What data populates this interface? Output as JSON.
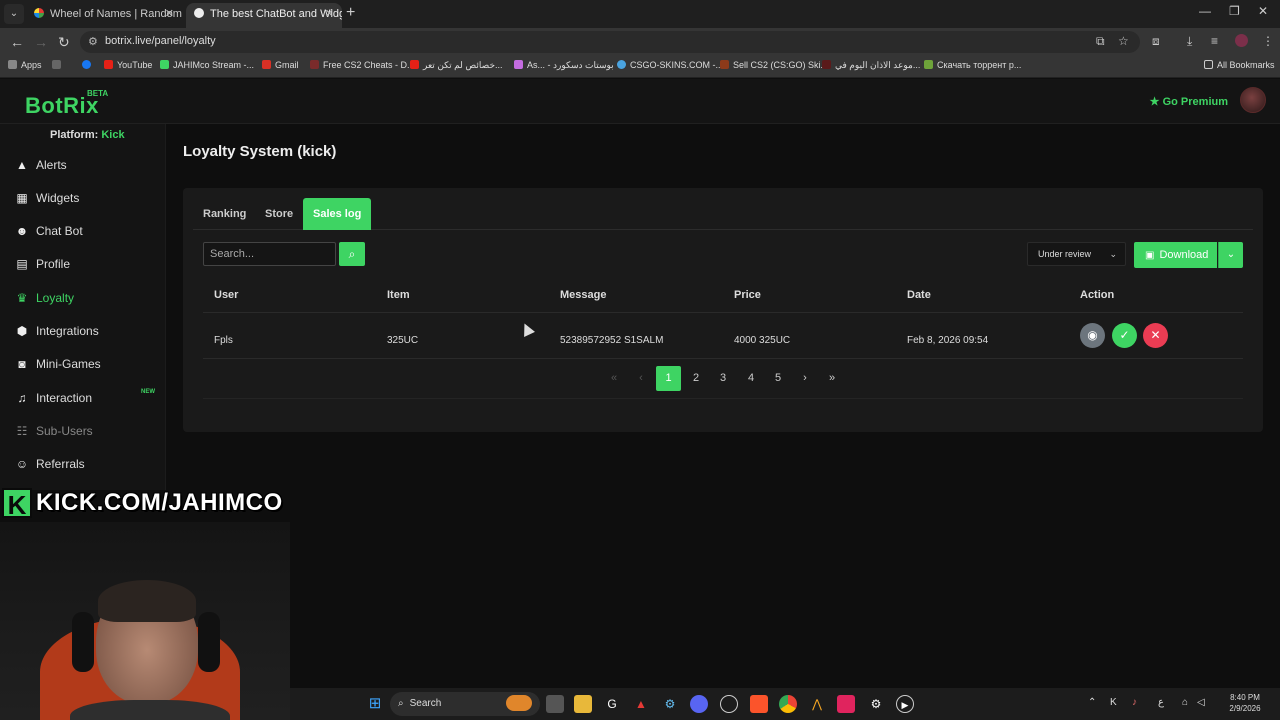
{
  "browser": {
    "tabs": [
      {
        "title": "Wheel of Names | Random name",
        "active": false
      },
      {
        "title": "The best ChatBot and Widgets",
        "active": true
      }
    ],
    "url": "botrix.live/panel/loyalty",
    "bookmarks": [
      {
        "label": "Apps"
      },
      {
        "label": ""
      },
      {
        "label": ""
      },
      {
        "label": "YouTube"
      },
      {
        "label": "JAHIMco Stream -..."
      },
      {
        "label": "Gmail"
      },
      {
        "label": "Free CS2 Cheats - D..."
      },
      {
        "label": "خصائص لم تكن تعر..."
      },
      {
        "label": "As... - بوستات دسكورد"
      },
      {
        "label": "CSGO-SKINS.COM -..."
      },
      {
        "label": "Sell CS2 (CS:GO) Ski..."
      },
      {
        "label": "موعد الاذان اليوم في..."
      },
      {
        "label": "Скачать торрент р..."
      }
    ],
    "all_bookmarks": "All Bookmarks"
  },
  "app": {
    "logo": "BotRix",
    "beta": "BETA",
    "premium": "Go Premium",
    "platform_label": "Platform:",
    "platform_value": "Kick"
  },
  "sidebar": {
    "items": [
      {
        "label": "Alerts",
        "icon": "warning-icon",
        "active": false
      },
      {
        "label": "Widgets",
        "icon": "grid-icon",
        "active": false
      },
      {
        "label": "Chat Bot",
        "icon": "robot-icon",
        "active": false
      },
      {
        "label": "Profile",
        "icon": "id-card-icon",
        "active": false
      },
      {
        "label": "Loyalty",
        "icon": "trophy-icon",
        "active": true
      },
      {
        "label": "Integrations",
        "icon": "puzzle-icon",
        "active": false
      },
      {
        "label": "Mini-Games",
        "icon": "gamepad-icon",
        "active": false
      },
      {
        "label": "Interaction",
        "icon": "music-icon",
        "active": false,
        "badge": "NEW"
      },
      {
        "label": "Sub-Users",
        "icon": "users-icon",
        "active": false,
        "disabled": true
      },
      {
        "label": "Referrals",
        "icon": "user-plus-icon",
        "active": false
      }
    ]
  },
  "main": {
    "title": "Loyalty System (kick)",
    "tabs": [
      {
        "label": "Ranking",
        "active": false
      },
      {
        "label": "Store",
        "active": false
      },
      {
        "label": "Sales log",
        "active": true
      }
    ],
    "search_placeholder": "Search...",
    "status_filter": "Under review",
    "download_label": "Download",
    "table": {
      "headers": [
        "User",
        "Item",
        "Message",
        "Price",
        "Date",
        "Action"
      ],
      "rows": [
        {
          "user": "Fpls",
          "item": "325UC",
          "message": "52389572952 S1SALM",
          "price": "4000 325UC",
          "date": "Feb 8, 2026 09:54"
        }
      ]
    },
    "pagination": {
      "pages": [
        "1",
        "2",
        "3",
        "4",
        "5"
      ],
      "current": "1"
    }
  },
  "overlay": {
    "kick_letter": "K",
    "kick_text": "KICK.COM/JAHIMCO"
  },
  "taskbar": {
    "search_label": "Search",
    "time": "8:40 PM",
    "date": "2/9/2026"
  },
  "colors": {
    "accent": "#3ed463",
    "danger": "#ea3c53",
    "secondary": "#6c757d",
    "background": "#0e0e0e",
    "panel": "#1a1a1a"
  }
}
